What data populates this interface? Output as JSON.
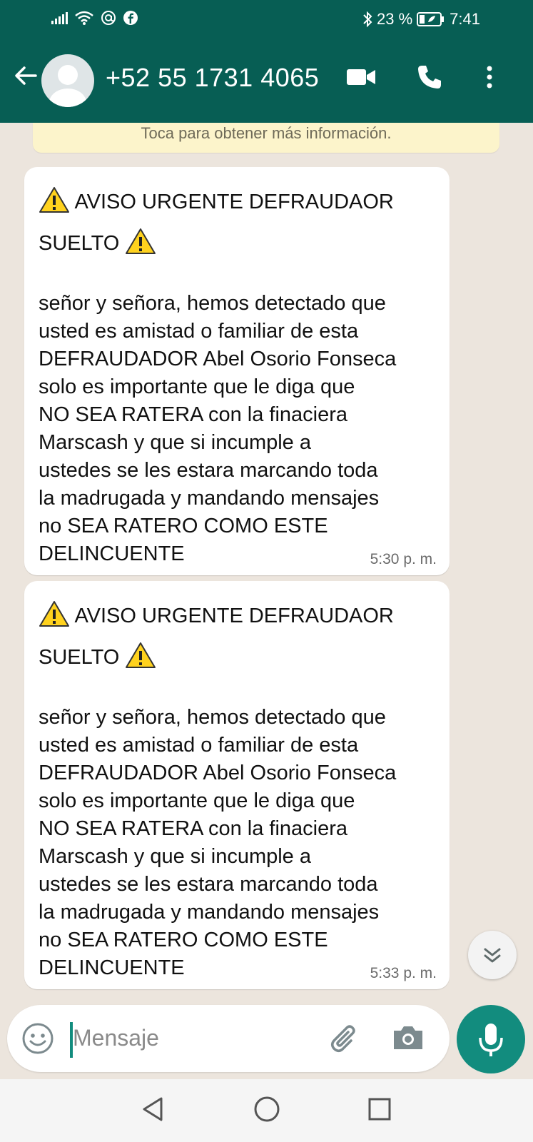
{
  "status_bar": {
    "battery": "23 %",
    "time": "7:41",
    "icons": [
      "signal-icon",
      "wifi-icon",
      "at-icon",
      "facebook-icon",
      "bluetooth-icon",
      "battery-icon"
    ]
  },
  "header": {
    "contact_name": "+52 55 1731 4065",
    "icons": [
      "back-arrow-icon",
      "avatar",
      "video-call-icon",
      "phone-icon",
      "more-vert-icon"
    ]
  },
  "info_banner": "Toca para obtener más información.",
  "messages": [
    {
      "head_line1": "AVISO URGENTE DEFRAUDAOR",
      "head_line2": "SUELTO",
      "body": "señor y señora, hemos detectado que\nusted es amistad o familiar de esta\nDEFRAUDADOR Abel Osorio Fonseca\nsolo es importante que le diga que\nNO SEA RATERA con la finaciera\nMarscash y que si incumple a\nustedes se les estara marcando  toda\nla madrugada y mandando mensajes\nno SEA RATERO COMO ESTE\nDELINCUENTE",
      "time": "5:30 p. m."
    },
    {
      "head_line1": "AVISO URGENTE DEFRAUDAOR",
      "head_line2": "SUELTO",
      "body": "señor y señora, hemos detectado que\nusted es amistad o familiar de esta\nDEFRAUDADOR Abel Osorio Fonseca\nsolo es importante que le diga que\nNO SEA RATERA con la finaciera\nMarscash y que si incumple a\nustedes se les estara marcando  toda\nla madrugada y mandando mensajes\nno SEA RATERO COMO ESTE\nDELINCUENTE",
      "time": "5:33 p. m."
    }
  ],
  "composer": {
    "placeholder": "Mensaje"
  },
  "colors": {
    "header": "#075e54",
    "accent": "#128c7e",
    "chat_bg": "#ece5dd",
    "bubble": "#ffffff",
    "info_banner": "#fcf4cb"
  }
}
